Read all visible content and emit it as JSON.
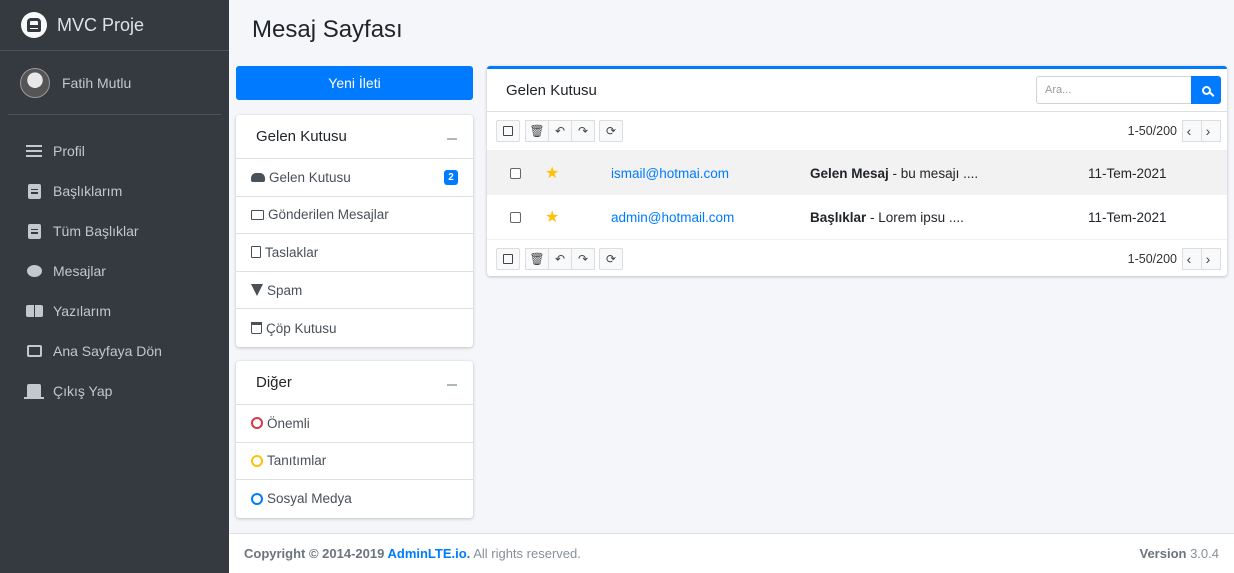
{
  "brand": {
    "title": "MVC Proje"
  },
  "user": {
    "name": "Fatih Mutlu"
  },
  "sidebar": {
    "items": [
      {
        "label": "Profil",
        "icon": "list-icon"
      },
      {
        "label": "Başlıklarım",
        "icon": "document-icon"
      },
      {
        "label": "Tüm Başlıklar",
        "icon": "document-icon"
      },
      {
        "label": "Mesajlar",
        "icon": "chat-icon"
      },
      {
        "label": "Yazılarım",
        "icon": "book-icon"
      },
      {
        "label": "Ana Sayfaya Dön",
        "icon": "image-icon"
      },
      {
        "label": "Çıkış Yap",
        "icon": "door-icon"
      }
    ]
  },
  "page": {
    "title": "Mesaj Sayfası"
  },
  "compose": {
    "label": "Yeni İleti"
  },
  "folders": {
    "title": "Gelen Kutusu",
    "items": [
      {
        "label": "Gelen Kutusu",
        "badge": "2"
      },
      {
        "label": "Gönderilen Mesajlar"
      },
      {
        "label": "Taslaklar"
      },
      {
        "label": "Spam"
      },
      {
        "label": "Çöp Kutusu"
      }
    ]
  },
  "labels": {
    "title": "Diğer",
    "items": [
      {
        "label": "Önemli",
        "color": "#dc3545"
      },
      {
        "label": "Tanıtımlar",
        "color": "#ffc107"
      },
      {
        "label": "Sosyal Medya",
        "color": "#007bff"
      }
    ]
  },
  "mailbox": {
    "title": "Gelen Kutusu",
    "search_placeholder": "Ara...",
    "pager": "1-50/200",
    "messages": [
      {
        "from": "ismail@hotmai.com",
        "subject": "Gelen Mesaj",
        "preview": " - bu mesajı ....",
        "date": "11-Tem-2021",
        "starred": true
      },
      {
        "from": "admin@hotmail.com",
        "subject": "Başlıklar",
        "preview": " - Lorem ipsu ....",
        "date": "11-Tem-2021",
        "starred": true
      }
    ]
  },
  "footer": {
    "copyright_prefix": "Copyright © 2014-2019 ",
    "link": "AdminLTE.io.",
    "suffix": " All rights reserved.",
    "version_label": "Version",
    "version": " 3.0.4"
  },
  "colors": {
    "accent": "#007bff",
    "sidebar": "#343a40",
    "star": "#ffc107"
  }
}
